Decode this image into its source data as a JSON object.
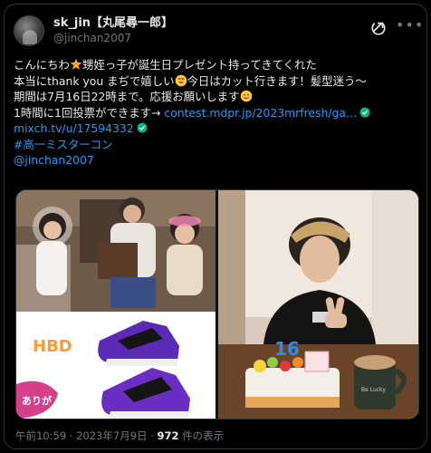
{
  "tweet": {
    "display_name": "sk_jin【丸尾尋一郎】",
    "handle": "@jinchan2007",
    "lines": {
      "l1_a": "こんにちわ",
      "l1_b": "甥姪っ子が誕生日プレゼント持ってきてくれた",
      "l2_a": "本当にthank you まぢで嬉しい",
      "l2_b": "今日はカット行きます！髪型迷う～",
      "l3": "期間は7月16日22時まで。応援お願いします",
      "l4_text": "1時間に1回投票ができます→ ",
      "l4_link": "contest.mdpr.jp/2023mrfresh/ga…",
      "l5_link": "mixch.tv/u/17594332",
      "l6_hashtag": "#高一ミスターコン",
      "l7_mention": "@jinchan2007"
    },
    "footer": {
      "time": "午前10:59 · 2023年7月9日 · ",
      "views": "972",
      "views_suffix": " 件の表示"
    },
    "photo_text": {
      "hbd": "HBD",
      "thanks": "ありが",
      "cake_candle": "16",
      "mug_text": "Be Lucky"
    }
  },
  "colors": {
    "link": "#1d9bf0",
    "text": "#e7e9ea",
    "muted": "#71767b",
    "verified": "#00ba7c",
    "shoe": "#6a2ec4"
  },
  "icons": [
    "avatar",
    "grok-icon",
    "more-icon",
    "star-emoji",
    "heart-eyes-emoji",
    "smile-emoji",
    "verified-badge-icon"
  ]
}
